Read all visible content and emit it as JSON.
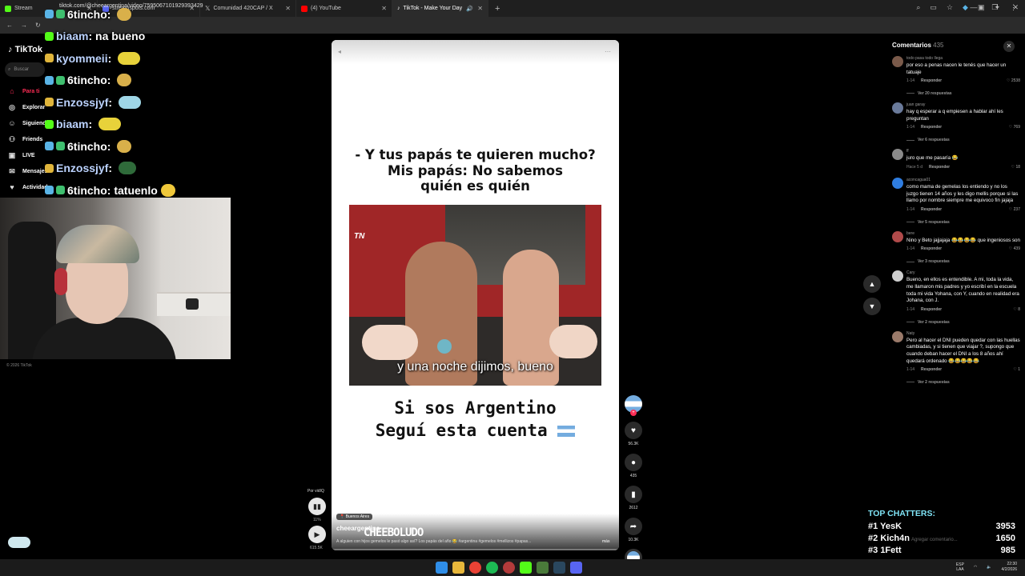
{
  "browser": {
    "tabs": [
      {
        "title": "Stream",
        "color": "#53fc18"
      },
      {
        "title": "streamspots.com",
        "color": "#5865f2"
      },
      {
        "title": "Comunidad 420CAP / X",
        "color": "#ffffff"
      },
      {
        "title": "(4) YouTube",
        "color": "#ff0000"
      },
      {
        "title": "TikTok - Make Your Day",
        "color": "#ffffff"
      }
    ],
    "url": "tiktok.com/@cheeargentina/video/7595067101929393429"
  },
  "sidebar": {
    "logo": "TikTok",
    "search_placeholder": "Buscar",
    "items": [
      {
        "label": "Para ti",
        "icon": "home-icon"
      },
      {
        "label": "Explorar",
        "icon": "compass-icon"
      },
      {
        "label": "Siguiendo",
        "icon": "following-icon"
      },
      {
        "label": "Friends",
        "icon": "friends-icon"
      },
      {
        "label": "LIVE",
        "icon": "live-icon"
      },
      {
        "label": "Mensajes",
        "icon": "messages-icon"
      },
      {
        "label": "Actividad",
        "icon": "activity-icon"
      }
    ],
    "copyright": "© 2026 TikTok"
  },
  "chat": [
    {
      "user": "6tincho",
      "text": "",
      "color": "#ffffff"
    },
    {
      "user": "biaam",
      "text": "na bueno",
      "color": "#ffffff"
    },
    {
      "user": "kyommeii",
      "text": "",
      "color": "#bcd3ff"
    },
    {
      "user": "6tincho",
      "text": "",
      "color": "#ffffff"
    },
    {
      "user": "Enzossjyf",
      "text": "",
      "color": "#bcd3ff"
    },
    {
      "user": "biaam",
      "text": "",
      "color": "#bcd3ff"
    },
    {
      "user": "6tincho",
      "text": "",
      "color": "#ffffff"
    },
    {
      "user": "Enzossjyf",
      "text": "",
      "color": "#bcd3ff"
    },
    {
      "user": "6tincho",
      "text": "tatuenlo",
      "color": "#ffffff"
    }
  ],
  "video": {
    "question": "- Y tus papás te quieren mucho?\nMis papás: No sabemos\nquién es quién",
    "photo_logo": "TN",
    "subtitle": "y una noche dijimos, bueno",
    "cta_line1": "Si sos Argentino",
    "cta_line2": "Seguí esta cuenta",
    "location": "Buenos Aires",
    "author": "cheeargentina",
    "watermark": "CHEEBOLUDO",
    "caption": "A alguien con hijos gemelos le pasó algo así? Los papás del año 😂 #argentina #gemelos #mellizos #papas...",
    "more": "más",
    "progress_fraction": 0
  },
  "player_controls": {
    "label": "Por vidIQ",
    "percent": "11%",
    "time": "615.5K"
  },
  "actions": {
    "likes": "56.3K",
    "comments": "435",
    "saves": "2612",
    "shares": "10.3K"
  },
  "comments_panel": {
    "title": "Comentarios",
    "count": "435",
    "reply_label": "Responder",
    "add_placeholder": "Agregar comentario...",
    "items": [
      {
        "user": "todo pasa todo llega",
        "text": "por eso a penas nacen le tenés que hacer un tatuaje",
        "date": "1-14",
        "likes": "2538",
        "replies": "Ver 20 respuestas"
      },
      {
        "user": "juan garay",
        "text": "hay q esperar a q empiesen a hablar ahí les preguntan",
        "date": "1-14",
        "likes": "769",
        "replies": "Ver 6 respuestas"
      },
      {
        "user": "ff",
        "text": "juro que me pasaría 😂",
        "date": "Hace 5 d",
        "likes": "18",
        "replies": ""
      },
      {
        "user": "aconcagua01",
        "text": "como mama de gemelas los entiendo y no los juzgo tienen 14 años y les digo mellis porque si las llamo por nombre siempre me equivoco fin jajaja",
        "date": "1-14",
        "likes": "237",
        "replies": "Ver 5 respuestas"
      },
      {
        "user": "bere",
        "text": "Nino y Beto jajjajaja 😂😂😂😂 que ingeniosos son",
        "date": "1-14",
        "likes": "439",
        "replies": "Ver 3 respuestas"
      },
      {
        "user": "Cary",
        "text": "Bueno, en ellos es entendible. A mi, toda la vida, me llamaron mis padres y yo escribí en la escuela toda mi vida Yohana, con Y, cuando en realidad era Johana, con J.",
        "date": "1-14",
        "likes": "8",
        "replies": "Ver 2 respuestas"
      },
      {
        "user": "Naty",
        "text": "Pero al hacer el DNI pueden quedar con las huellas cambiadas, y si tienen que viajar ?, supongo que cuando deban hacer el DNI a los 8 años ahí quedará ordenado 😂😂😂😂😂",
        "date": "1-14",
        "likes": "1",
        "replies": "Ver 2 respuestas"
      }
    ]
  },
  "top_chatters": {
    "title": "TOP CHATTERS:",
    "rows": [
      {
        "rank": "#1",
        "name": "YesK",
        "value": "3953"
      },
      {
        "rank": "#2",
        "name": "Kich4n",
        "value": "1650"
      },
      {
        "rank": "#3",
        "name": "1Fett",
        "value": "985"
      }
    ]
  },
  "taskbar": {
    "lang": "ESP\nLAA",
    "time": "22:30",
    "date": "4/2/2026"
  }
}
